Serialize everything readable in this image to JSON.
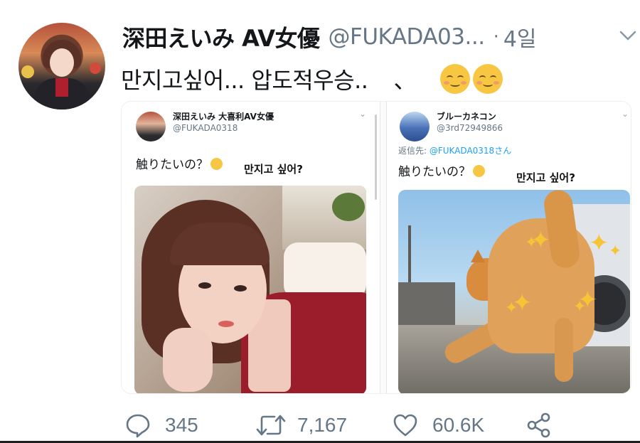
{
  "tweet": {
    "display_name": "深田えいみ AV女優",
    "handle": "@FUKADA03...",
    "separator": "·",
    "time": "4일",
    "text": "만지고싶어... 압도적우승..",
    "text_extra": "、"
  },
  "embedded": {
    "left": {
      "name": "深田えいみ 大喜利AV女優",
      "handle": "@FUKADA0318",
      "text": "触りたいの？",
      "overlay": "만지고 싶어?"
    },
    "right": {
      "name": "ブルーカネコン",
      "handle": "@3rd72949866",
      "reply_prefix": "返信先: ",
      "reply_handle": "@FUKADA0318さん",
      "text": "触りたいの？",
      "overlay": "만지고 싶어?"
    }
  },
  "actions": {
    "replies": "345",
    "retweets": "7,167",
    "likes": "60.6K"
  },
  "colors": {
    "text_primary": "#14171a",
    "text_secondary": "#657786",
    "link": "#1da1f2"
  }
}
